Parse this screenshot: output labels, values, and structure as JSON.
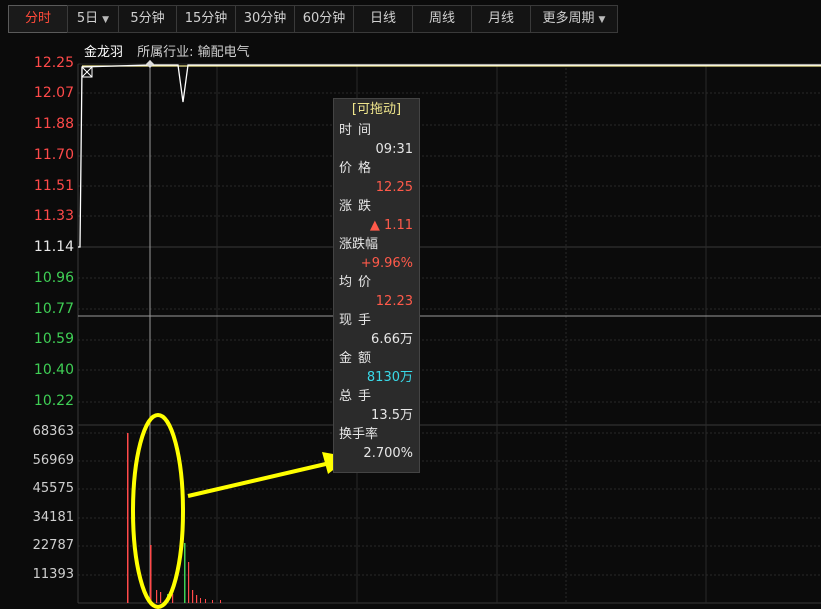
{
  "tabs": [
    {
      "label": "分时",
      "active": true
    },
    {
      "label": "5日",
      "dropdown": true
    },
    {
      "label": "5分钟"
    },
    {
      "label": "15分钟"
    },
    {
      "label": "30分钟"
    },
    {
      "label": "60分钟"
    },
    {
      "label": "日线"
    },
    {
      "label": "周线"
    },
    {
      "label": "月线"
    },
    {
      "label": "更多周期",
      "dropdown": true
    }
  ],
  "stock": {
    "name": "金龙羽",
    "industry": "所属行业: 输配电气"
  },
  "price_axis": {
    "labels": [
      "12.25",
      "12.07",
      "11.88",
      "11.70",
      "11.51",
      "11.33",
      "11.14",
      "10.96",
      "10.77",
      "10.59",
      "10.40",
      "10.22"
    ],
    "reference": "11.14"
  },
  "volume_axis": {
    "labels": [
      "68363",
      "56969",
      "45575",
      "34181",
      "22787",
      "11393"
    ]
  },
  "tooltip": {
    "header": "[可拖动]",
    "rows": [
      {
        "label": "时间",
        "value": "09:31",
        "tone": "white"
      },
      {
        "label": "价格",
        "value": "12.25",
        "tone": "red"
      },
      {
        "label": "涨跌",
        "value": "▲ 1.11",
        "tone": "red"
      },
      {
        "label": "涨跌幅",
        "value": "+9.96%",
        "tone": "red"
      },
      {
        "label": "均价",
        "value": "12.23",
        "tone": "red"
      },
      {
        "label": "现手",
        "value": "6.66万",
        "tone": "white"
      },
      {
        "label": "金额",
        "value": "8130万",
        "tone": "cyan"
      },
      {
        "label": "总手",
        "value": "13.5万",
        "tone": "white"
      },
      {
        "label": "换手率",
        "value": "2.700%",
        "tone": "white"
      }
    ]
  },
  "colors": {
    "up": "#ff4a4a",
    "down": "#3fcf55",
    "annotation": "#ffff00",
    "price_line": "#ffffff",
    "avg_line": "#f0e68c"
  }
}
